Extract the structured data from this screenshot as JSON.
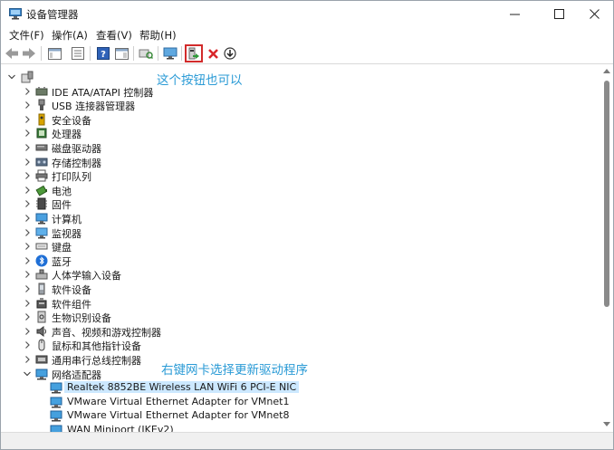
{
  "window": {
    "title": "设备管理器",
    "controls": {
      "minimize": "—",
      "maximize": "☐",
      "close": "✕"
    }
  },
  "menu": [
    "文件(F)",
    "操作(A)",
    "查看(V)",
    "帮助(H)"
  ],
  "toolbar": {
    "buttons": [
      "back-icon",
      "forward-icon",
      "show-hide-console-icon",
      "properties-icon",
      "help-icon",
      "action-pane-icon",
      "scan-hardware-icon",
      "monitor-icon",
      "update-driver-icon",
      "uninstall-device-icon",
      "disable-device-icon"
    ]
  },
  "tree": {
    "root_icon": "computer-icon",
    "items": [
      {
        "label": "IDE ATA/ATAPI 控制器",
        "icon": "ide-controller-icon"
      },
      {
        "label": "USB 连接器管理器",
        "icon": "usb-icon"
      },
      {
        "label": "安全设备",
        "icon": "security-key-icon"
      },
      {
        "label": "处理器",
        "icon": "processor-icon"
      },
      {
        "label": "磁盘驱动器",
        "icon": "disk-drive-icon"
      },
      {
        "label": "存储控制器",
        "icon": "storage-controller-icon"
      },
      {
        "label": "打印队列",
        "icon": "printer-icon"
      },
      {
        "label": "电池",
        "icon": "battery-icon"
      },
      {
        "label": "固件",
        "icon": "firmware-icon"
      },
      {
        "label": "计算机",
        "icon": "computer-monitor-icon"
      },
      {
        "label": "监视器",
        "icon": "monitor-display-icon"
      },
      {
        "label": "键盘",
        "icon": "keyboard-icon"
      },
      {
        "label": "蓝牙",
        "icon": "bluetooth-icon"
      },
      {
        "label": "人体学输入设备",
        "icon": "hid-icon"
      },
      {
        "label": "软件设备",
        "icon": "software-device-icon"
      },
      {
        "label": "软件组件",
        "icon": "software-component-icon"
      },
      {
        "label": "生物识别设备",
        "icon": "biometric-icon"
      },
      {
        "label": "声音、视频和游戏控制器",
        "icon": "sound-icon"
      },
      {
        "label": "鼠标和其他指针设备",
        "icon": "mouse-icon"
      },
      {
        "label": "通用串行总线控制器",
        "icon": "usb-controller-icon"
      },
      {
        "label": "网络适配器",
        "icon": "network-adapter-icon",
        "expanded": true
      }
    ],
    "children": [
      {
        "label": "Realtek 8852BE Wireless LAN WiFi 6 PCI-E NIC",
        "selected": true
      },
      {
        "label": "VMware Virtual Ethernet Adapter for VMnet1"
      },
      {
        "label": "VMware Virtual Ethernet Adapter for VMnet8"
      },
      {
        "label": "WAN Miniport (IKEv2)"
      }
    ]
  },
  "annotations": {
    "toolbar_hint": "这个按钮也可以",
    "network_hint": "右键网卡选择更新驱动程序"
  },
  "colors": {
    "annotation": "#2b9bd6",
    "highlight_box": "#d22b2b",
    "selection": "#cce8ff"
  }
}
